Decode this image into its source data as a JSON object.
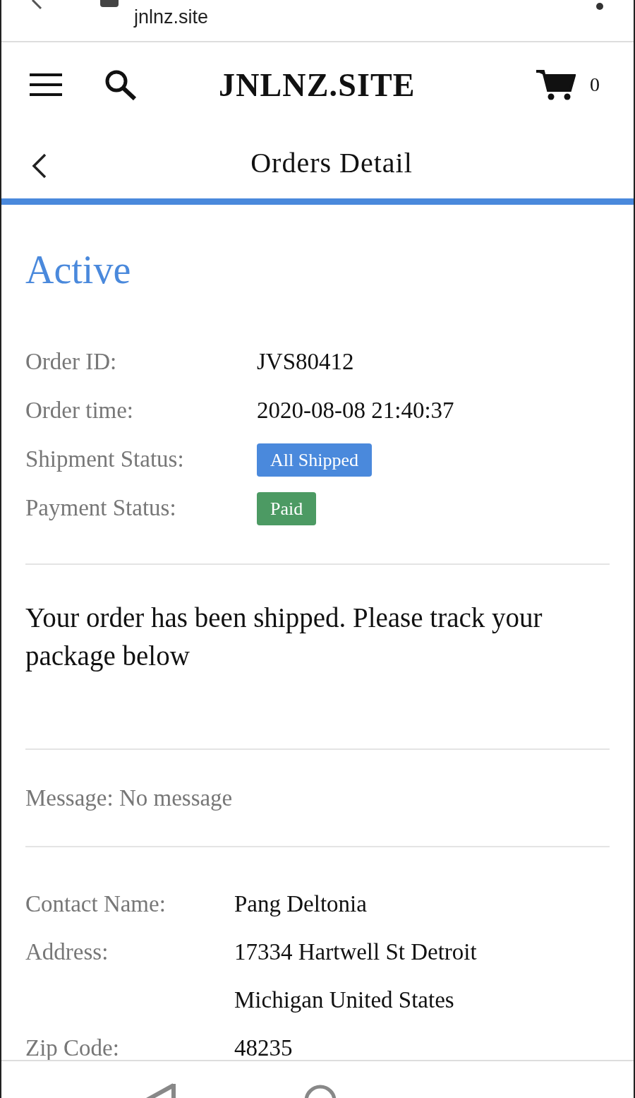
{
  "browser": {
    "url": "jnlnz.site"
  },
  "header": {
    "logo": "JNLNZ.SITE",
    "cart_count": "0"
  },
  "subheader": {
    "title": "Orders Detail"
  },
  "status_title": "Active",
  "order_fields": [
    {
      "label": "Order ID:",
      "kind": "text",
      "value": "JVS80412"
    },
    {
      "label": "Order time:",
      "kind": "text",
      "value": "2020-08-08 21:40:37"
    },
    {
      "label": "Shipment Status:",
      "kind": "badge",
      "value": "All Shipped",
      "color": "#4a89dc"
    },
    {
      "label": "Payment Status:",
      "kind": "badge",
      "value": "Paid",
      "color": "#4c9a63"
    }
  ],
  "notice": "Your order has been shipped. Please track your package below",
  "message": "Message: No message",
  "contact_fields": [
    {
      "label": "Contact Name:",
      "lines": [
        "Pang Deltonia"
      ]
    },
    {
      "label": "Address:",
      "lines": [
        "17334 Hartwell St Detroit",
        "Michigan United States"
      ]
    },
    {
      "label": "Zip Code:",
      "lines": [
        "48235"
      ]
    }
  ]
}
